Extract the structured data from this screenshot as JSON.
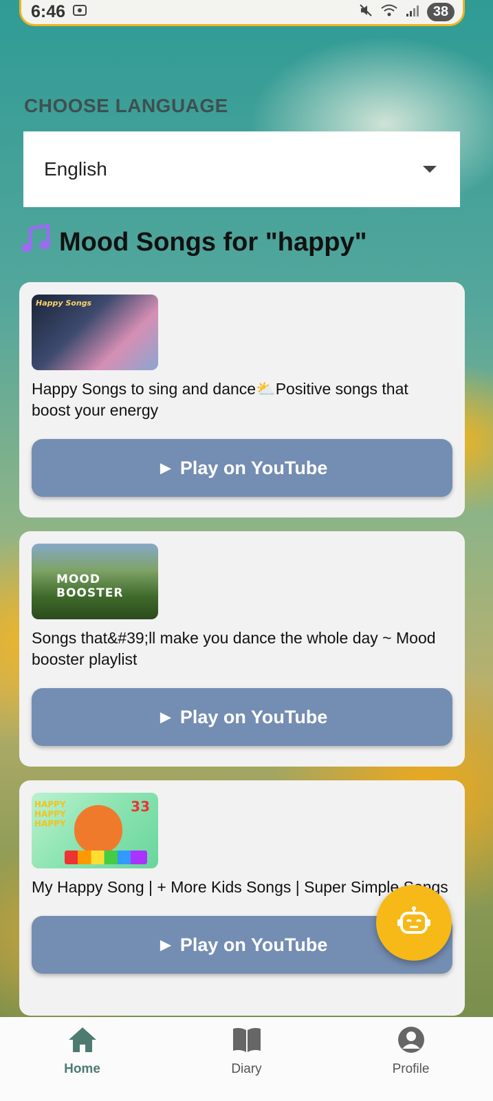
{
  "status_bar": {
    "time": "6:46",
    "battery": "38"
  },
  "language": {
    "label": "CHOOSE LANGUAGE",
    "selected": "English"
  },
  "section": {
    "title": "Mood Songs for \"happy\""
  },
  "cards": [
    {
      "thumbnail_text": "Happy Songs",
      "title": "Happy Songs to sing and dance⛅Positive songs that boost your energy",
      "button": "► Play on YouTube"
    },
    {
      "thumbnail_text": "MOOD BOOSTER",
      "title": "Songs that&#39;ll make you dance the whole day ~ Mood booster playlist",
      "button": "► Play on YouTube"
    },
    {
      "thumbnail_text": "HAPPY HAPPY HAPPY",
      "thumbnail_badge": "33",
      "title": "My Happy Song | + More Kids Songs | Super Simple Songs",
      "button": "► Play on YouTube"
    }
  ],
  "bottom_nav": {
    "items": [
      {
        "label": "Home",
        "icon": "home-icon",
        "active": true
      },
      {
        "label": "Diary",
        "icon": "book-icon",
        "active": false
      },
      {
        "label": "Profile",
        "icon": "profile-icon",
        "active": false
      }
    ]
  },
  "colors": {
    "accent": "#f6b917",
    "button": "#748db2",
    "active_nav": "#4e7b70"
  }
}
